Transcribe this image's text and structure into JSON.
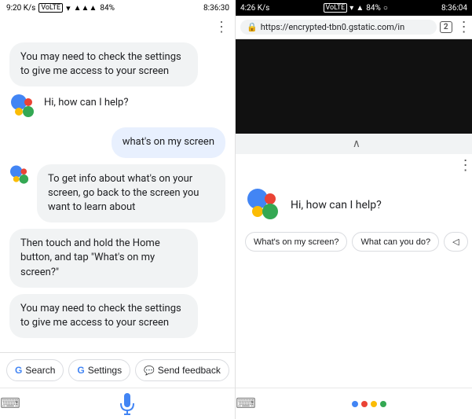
{
  "left_status": {
    "speed": "9:20 K/s",
    "network": "VoLTE",
    "battery": "84%",
    "time": "8:36:30"
  },
  "right_status": {
    "speed": "4:26 K/s",
    "network": "VoLTE",
    "battery": "84%",
    "time": "8:36:04"
  },
  "browser": {
    "url": "https://encrypted-tbn0.gstatic.com/in",
    "tab_count": "2"
  },
  "left_chat": {
    "bubble1": "You may need to check the settings to give me access to your screen",
    "bubble_hi": "Hi, how can I help?",
    "bubble_user": "what's on my screen",
    "bubble2": "To get info about what's on your screen, go back to the screen you want to learn about",
    "bubble3": "Then touch and hold the Home button, and tap \"What's on my screen?\"",
    "bubble4": "You may need to check the settings to give me access to your screen"
  },
  "left_actions": {
    "search": "Search",
    "settings": "Settings",
    "feedback": "Send feedback"
  },
  "right_assistant": {
    "greeting": "Hi, how can I help?",
    "chip1": "What's on my screen?",
    "chip2": "What can you do?",
    "chip3": "◁"
  },
  "colors": {
    "blue": "#4285F4",
    "red": "#EA4335",
    "yellow": "#FBBC05",
    "green": "#34A853"
  }
}
